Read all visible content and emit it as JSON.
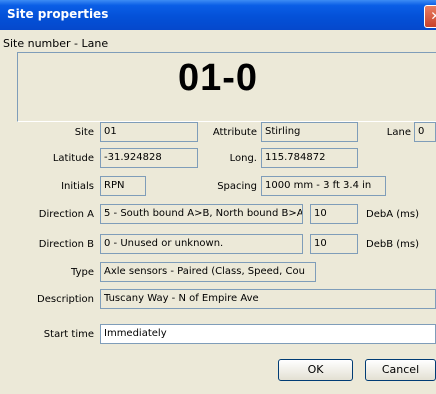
{
  "window": {
    "title": "Site properties",
    "close_icon": "close-icon"
  },
  "header": {
    "label": "Site number - Lane",
    "number": "01-0"
  },
  "fields": {
    "site": {
      "label": "Site",
      "value": "01"
    },
    "attribute": {
      "label": "Attribute",
      "value": "Stirling"
    },
    "lane": {
      "label": "Lane",
      "value": "0"
    },
    "latitude": {
      "label": "Latitude",
      "value": "-31.924828"
    },
    "longitude": {
      "label": "Long.",
      "value": "115.784872"
    },
    "initials": {
      "label": "Initials",
      "value": "RPN"
    },
    "spacing": {
      "label": "Spacing",
      "value": "1000 mm - 3 ft 3.4 in"
    },
    "direction_a": {
      "label": "Direction A",
      "value": "5 - South bound A>B, North bound B>A.",
      "deb_value": "10",
      "deb_label": "DebA (ms)"
    },
    "direction_b": {
      "label": "Direction B",
      "value": "0 - Unused or unknown.",
      "deb_value": "10",
      "deb_label": "DebB (ms)"
    },
    "type": {
      "label": "Type",
      "value": "Axle sensors - Paired (Class, Speed, Cou"
    },
    "description": {
      "label": "Description",
      "value": "Tuscany Way - N of Empire Ave"
    },
    "start_time": {
      "label": "Start time",
      "value": "Immediately"
    }
  },
  "buttons": {
    "ok": "OK",
    "cancel": "Cancel"
  }
}
